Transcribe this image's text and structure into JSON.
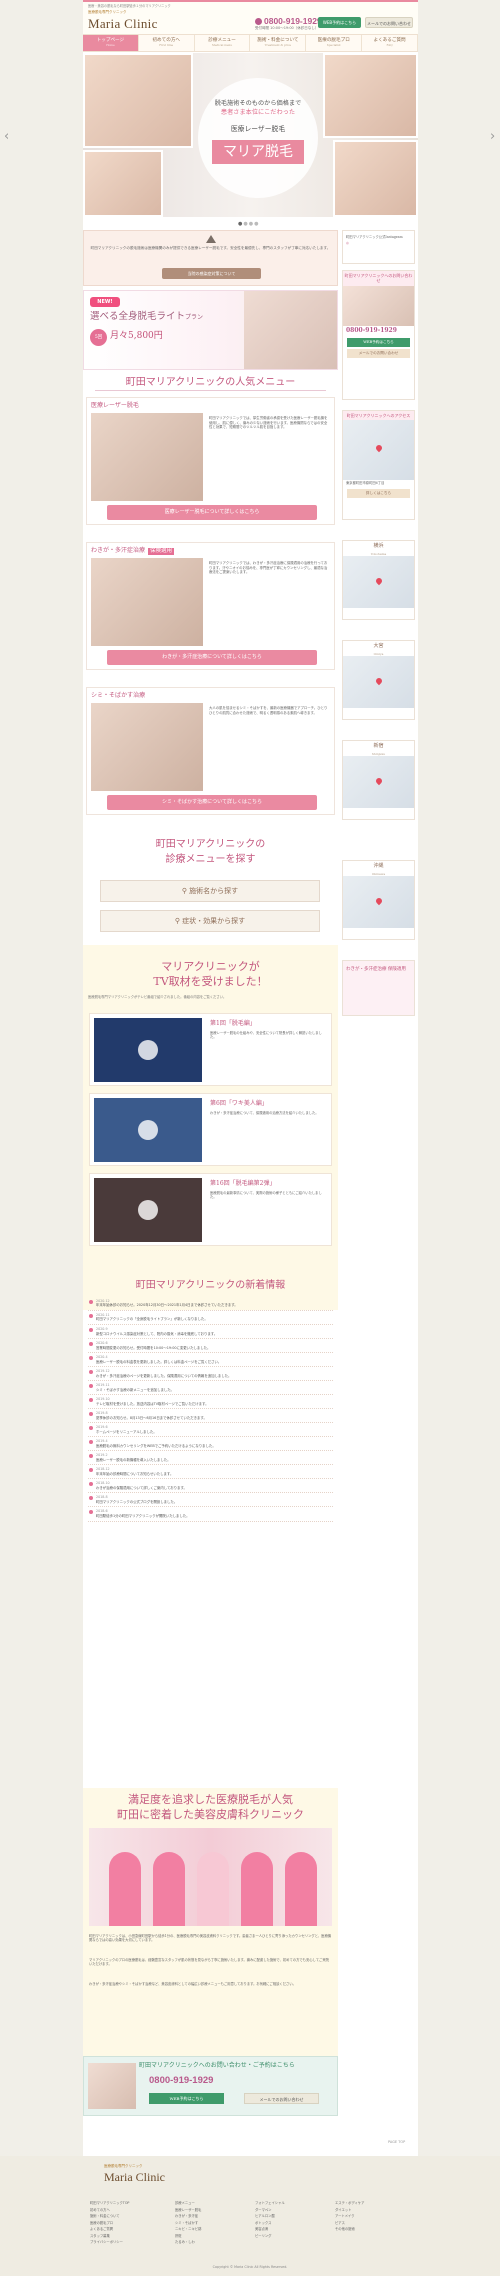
{
  "header": {
    "tagline": "医療・美容の脱毛なら町田駅徒歩１分のマリアクリニック",
    "logo_sub": "医療脱毛専門クリニック",
    "logo": "Maria Clinic",
    "phone": "0800-919-1929",
    "hours": "受付時間 10:00〜19:00（休診日なし）",
    "web_reserve": "WEB予約はこちら",
    "contact": "メールでのお問い合わせ"
  },
  "nav": [
    {
      "label": "トップページ",
      "sub": "Home"
    },
    {
      "label": "初めての方へ",
      "sub": "First time"
    },
    {
      "label": "診療メニュー",
      "sub": "Medical menu"
    },
    {
      "label": "施術・料金について",
      "sub": "Treatment & price"
    },
    {
      "label": "医療の脱毛プロ",
      "sub": "Specialist"
    },
    {
      "label": "よくあるご質問",
      "sub": "FAQ"
    }
  ],
  "hero": {
    "line1": "脱毛施術そのものから価格まで",
    "line2": "",
    "line2b": "患者さま本位にこだわった",
    "line3": "医療レーザー脱毛",
    "title": "マリア脱毛"
  },
  "notice": {
    "text": "町田マリアクリニックの脱毛施術は医療機関のみが提供できる医療レーザー脱毛です。安全性を最優先し、専門のスタッフが丁寧に対応いたします。",
    "button": "当院の感染症対策について"
  },
  "promo": {
    "new": "NEW!",
    "title": "選べる全身脱毛ライト",
    "title_suffix": "プラン",
    "count": "5回",
    "price": "月々5,800円"
  },
  "popular": {
    "title": "町田マリアクリニックの人気メニュー",
    "items": [
      {
        "title": "医療レーザー脱毛",
        "badge": "",
        "text": "町田マリアクリニックでは、厚生労働省の承認を受けた医療レーザー脱毛機を使用し、肌に優しく、痛みの少ない施術を行います。医療機関ならではの安全性と効果で、短期間でのツルツル肌を目指します。",
        "button": "医療レーザー脱毛について詳しくはこちら"
      },
      {
        "title": "わきが・多汗症治療",
        "badge": "保険適用",
        "text": "町田マリアクリニックでは、わきが・多汗症治療に保険適用の治療を行っております。汗やニオイのお悩みを、専門医が丁寧にカウンセリングし、最適な治療法をご提案いたします。",
        "button": "わきが・多汗症治療について詳しくはこちら"
      },
      {
        "title": "シミ・そばかす治療",
        "badge": "",
        "text": "大人の肌を悩ませるシミ・そばかすを、最新の医療機器でアプローチ。ひとりひとりの肌質に合わせた施術で、明るく透明感のある素肌へ導きます。",
        "button": "シミ・そばかす治療について詳しくはこちら"
      }
    ]
  },
  "search": {
    "title1": "町田マリアクリニックの",
    "title2": "診療メニューを探す",
    "btn1": "施術名から探す",
    "btn2": "症状・効果から探す"
  },
  "tv": {
    "title1": "マリアクリニックが",
    "title2": "TV取材を受けました！",
    "intro": "医療脱毛専門マリアクリニックがテレビ番組で紹介されました。番組の内容をご覧ください。",
    "videos": [
      {
        "title": "第1回「脱毛編」",
        "text": "医療レーザー脱毛の仕組みや、安全性について院長が詳しく解説いたしました。"
      },
      {
        "title": "第6回「ワキ美人編」",
        "text": "わきが・多汗症治療について、保険適用の治療方法を紹介いたしました。"
      },
      {
        "title": "第16回「脱毛編第2弾」",
        "text": "医療脱毛の最新事情について、実際の施術の様子とともにご紹介いたしました。"
      }
    ]
  },
  "news": {
    "title": "町田マリアクリニックの新着情報",
    "items": [
      {
        "date": "2020.12",
        "text": "年末年始休診のお知らせ。2020年12月30日〜2021年1月4日まで休診させていただきます。"
      },
      {
        "date": "2020.11",
        "text": "町田マリアクリニックの「全身脱毛ライトプラン」が新しくなりました。"
      },
      {
        "date": "2020.9",
        "text": "新型コロナウイルス感染症対策として、院内の換気・消毒を徹底しております。"
      },
      {
        "date": "2020.6",
        "text": "営業時間変更のお知らせ。受付時間を10:00〜19:00に変更いたしました。"
      },
      {
        "date": "2020.4",
        "text": "医療レーザー脱毛の料金表を更新しました。詳しくは料金ページをご覧ください。"
      },
      {
        "date": "2019.12",
        "text": "わきが・多汗症治療のページを更新しました。保険適用についての情報を追加しました。"
      },
      {
        "date": "2019.11",
        "text": "シミ・そばかす治療の新メニューを追加しました。"
      },
      {
        "date": "2019.10",
        "text": "テレビ取材を受けました。放送内容はTV取材ページでご覧いただけます。"
      },
      {
        "date": "2019.8",
        "text": "夏季休診のお知らせ。8月13日〜8月16日まで休診させていただきます。"
      },
      {
        "date": "2019.6",
        "text": "ホームページをリニューアルしました。"
      },
      {
        "date": "2019.4",
        "text": "医療脱毛の無料カウンセリングをWEBでご予約いただけるようになりました。"
      },
      {
        "date": "2019.2",
        "text": "医療レーザー脱毛の新機種を導入いたしました。"
      },
      {
        "date": "2018.12",
        "text": "年末年始の診療時間についてお知らせいたします。"
      },
      {
        "date": "2018.10",
        "text": "わきが治療の保険適用について詳しくご案内しております。"
      },
      {
        "date": "2018.8",
        "text": "町田マリアクリニックの公式ブログを開設しました。"
      },
      {
        "date": "2018.6",
        "text": "町田駅徒歩1分の町田マリアクリニックが開院いたしました。"
      }
    ]
  },
  "about": {
    "title1": "満足度を追求した医療脱毛が人気",
    "title2": "町田に密着した美容皮膚科クリニック",
    "para1": "町田マリアクリニックは、小田急線町田駅から徒歩1分の、医療脱毛専門の美容皮膚科クリニックです。患者さま一人ひとりに寄り添ったカウンセリングと、医療機関ならではの高い効果を大切にしています。",
    "para2": "マリアクリニックのプロの医療脱毛は、経験豊富なスタッフが肌の状態を見ながら丁寧に施術いたします。痛みに配慮した施術で、初めての方でも安心してご来院いただけます。",
    "para3": "わきが・多汗症治療やシミ・そばかす治療など、美容皮膚科としての幅広い診療メニューもご用意しております。お気軽にご相談ください。"
  },
  "cta": {
    "title": "町田マリアクリニックへのお問い合わせ・ご予約はこちら",
    "phone": "0800-919-1929",
    "btn1": "WEB予約はこちら",
    "btn2": "メールでのお問い合わせ"
  },
  "sidebar": {
    "insta": "町田マリアクリニック公式Instagram",
    "contact_hd": "町田マリアクリニックへのお問い合わせ",
    "contact_tel": "0800-919-1929",
    "contact_btn": "WEB予約はこちら",
    "contact_btn2": "メールでのお問い合わせ",
    "access_hd": "町田マリアクリニックへのアクセス",
    "access_text": "東京都町田市原町田6丁目",
    "access_btn": "詳しくはこちら",
    "regions": [
      {
        "name": "横浜",
        "sub": "Yokohama"
      },
      {
        "name": "大宮",
        "sub": "Omiya"
      },
      {
        "name": "新宿",
        "sub": "Shinjuku"
      },
      {
        "name": "沖縄",
        "sub": "Okinawa"
      }
    ],
    "banner": "わきが・多汗症治療 保険適用"
  },
  "pagetop": "PAGE TOP",
  "footer": {
    "logo_sub": "医療脱毛専門クリニック",
    "logo": "Maria Clinic",
    "col1": [
      "町田マリアクリニックTOP",
      "初めての方へ",
      "施術・料金について",
      "医療の脱毛プロ",
      "よくあるご質問",
      "スタッフ募集",
      "プライバシーポリシー"
    ],
    "col2": [
      "診療メニュー",
      "医療レーザー脱毛",
      "わきが・多汗症",
      "シミ・そばかす",
      "ニキビ・ニキビ跡",
      "肝斑",
      "たるみ・しわ"
    ],
    "col3": [
      "フォトフェイシャル",
      "ダーマペン",
      "ヒアルロン酸",
      "ボトックス",
      "美容点滴",
      "ピーリング"
    ],
    "col4": [
      "エステ・ボディケア",
      "ダイエット",
      "アートメイク",
      "ピアス",
      "その他の施術"
    ],
    "copy": "Copyright © Maria Clinic All Rights Reserved."
  }
}
